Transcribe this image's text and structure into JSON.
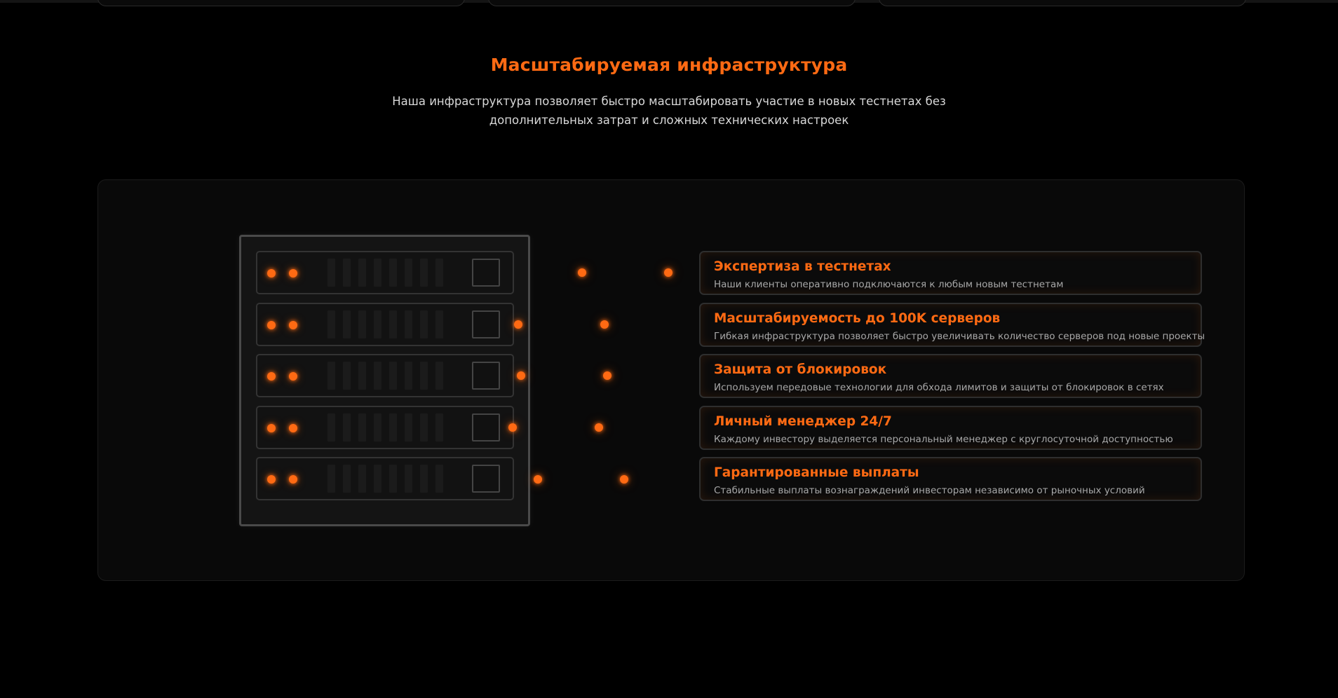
{
  "section": {
    "title": "Масштабируемая инфраструктура",
    "subtitle": "Наша инфраструктура позволяет быстро масштабировать участие в новых тестнетах без дополнительных затрат и сложных технических настроек"
  },
  "features": [
    {
      "title": "Экспертиза в тестнетах",
      "description": "Наши клиенты оперативно подключаются к любым новым тестнетам"
    },
    {
      "title": "Масштабируемость до 100K серверов",
      "description": "Гибкая инфраструктура позволяет быстро увеличивать количество серверов под новые проекты"
    },
    {
      "title": "Защита от блокировок",
      "description": "Используем передовые технологии для обхода лимитов и защиты от блокировок в сетях"
    },
    {
      "title": "Личный менеджер 24/7",
      "description": "Каждому инвестору выделяется персональный менеджер с круглосуточной доступностью"
    },
    {
      "title": "Гарантированные выплаты",
      "description": "Стабильные выплаты вознаграждений инвесторам независимо от рыночных условий"
    }
  ],
  "colors": {
    "accent": "#ff6a13",
    "background": "#000000",
    "panel": "#090909"
  }
}
